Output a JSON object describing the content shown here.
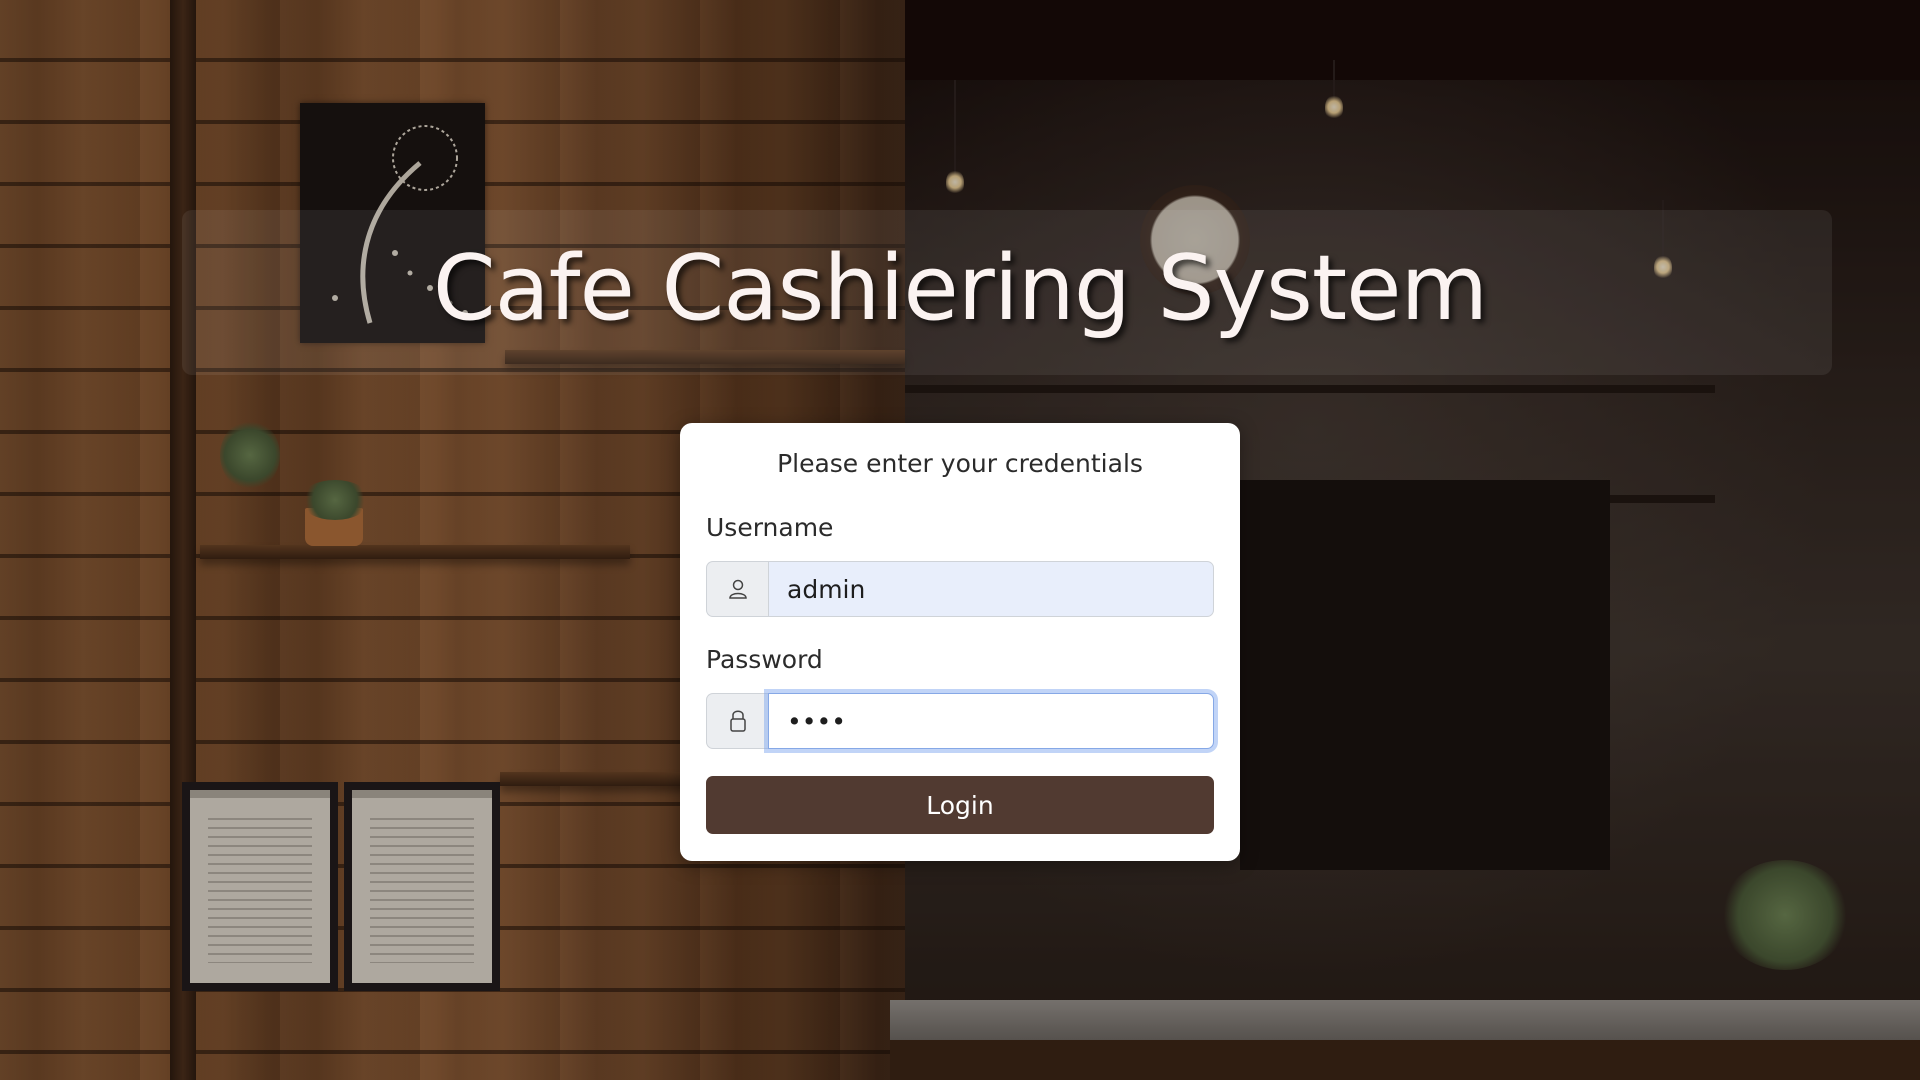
{
  "app": {
    "title": "Cafe Cashiering System"
  },
  "login_card": {
    "heading": "Please enter your credentials",
    "username": {
      "label": "Username",
      "value": "admin",
      "icon": "user-icon"
    },
    "password": {
      "label": "Password",
      "value": "••••",
      "icon": "lock-icon"
    },
    "submit_label": "Login"
  },
  "colors": {
    "button": "#513a31",
    "autofill_field": "#e8eefb",
    "focus_ring": "#86a8e6",
    "title_text": "#fbf3f1"
  }
}
